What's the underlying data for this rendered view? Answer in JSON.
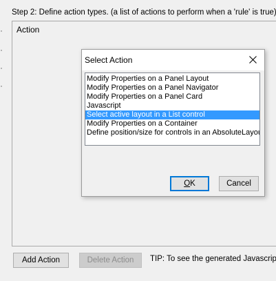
{
  "step": {
    "label": "Step 2: Define action types. (a list of actions to perform when a 'rule' is true)"
  },
  "action_panel": {
    "header": "Action"
  },
  "buttons": {
    "add_action": "Add Action",
    "delete_action": "Delete Action"
  },
  "tip": "TIP: To see the generated Javascript for",
  "dialog": {
    "title": "Select Action",
    "items": [
      {
        "label": "Modify Properties on a Panel Layout",
        "selected": false
      },
      {
        "label": "Modify Properties on a Panel Navigator",
        "selected": false
      },
      {
        "label": "Modify Properties on a Panel Card",
        "selected": false
      },
      {
        "label": "Javascript",
        "selected": false
      },
      {
        "label": "Select active layout in a List control",
        "selected": true
      },
      {
        "label": "Modify Properties on a Container",
        "selected": false
      },
      {
        "label": "Define position/size for controls in an AbsoluteLayout",
        "selected": false
      }
    ],
    "ok_mnemonic": "O",
    "ok_rest": "K",
    "cancel": "Cancel"
  },
  "colors": {
    "selection": "#3399ff",
    "default_button_border": "#0078d7"
  }
}
